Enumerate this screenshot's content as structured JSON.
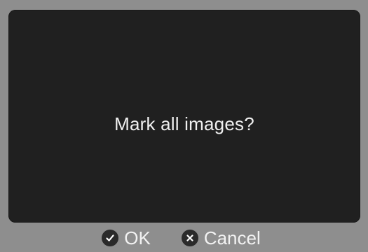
{
  "colors": {
    "background": "#8e8e8e",
    "dialog_panel": "#202020",
    "text": "#f0f0f0",
    "button_icon_bg": "#2a2a2a",
    "button_icon_glyph": "#ffffff"
  },
  "dialog": {
    "message": "Mark all images?"
  },
  "buttons": {
    "ok": {
      "label": "OK",
      "icon": "checkmark-icon"
    },
    "cancel": {
      "label": "Cancel",
      "icon": "close-icon"
    }
  }
}
